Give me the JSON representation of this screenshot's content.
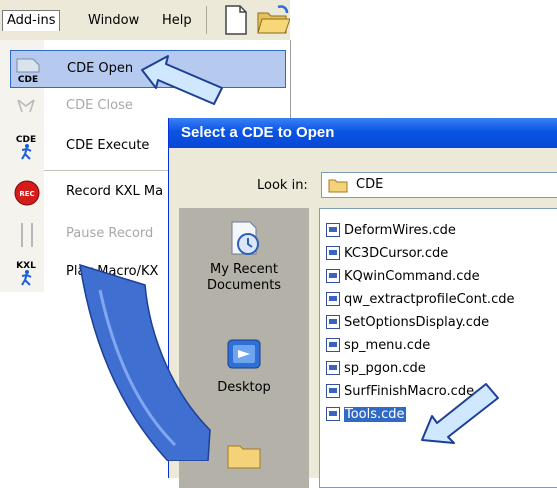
{
  "menubar": {
    "items": [
      {
        "label": "Add-ins",
        "active": true
      },
      {
        "label": "Window"
      },
      {
        "label": "Help"
      }
    ]
  },
  "menu": {
    "items": [
      {
        "label": "CDE Open",
        "icon": "cde-open-icon",
        "selected": true
      },
      {
        "label": "CDE Close",
        "icon": "cde-close-icon",
        "disabled": true
      },
      {
        "label": "CDE Execute",
        "icon": "cde-execute-icon"
      },
      {
        "label": "Record KXL Ma",
        "icon": "record-icon"
      },
      {
        "label": "Pause Record",
        "icon": "pause-icon",
        "disabled": true
      },
      {
        "label": "Play Macro/KX",
        "icon": "kxl-play-icon"
      }
    ],
    "icon_text": {
      "cde": "CDE",
      "rec": "REC",
      "kxl": "KXL"
    }
  },
  "dialog": {
    "title": "Select a CDE to Open",
    "look_in_label": "Look in:",
    "look_in_value": "CDE",
    "places": [
      {
        "label": "My Recent Documents",
        "icon": "recent-documents-icon"
      },
      {
        "label": "Desktop",
        "icon": "desktop-icon"
      }
    ],
    "files": [
      "DeformWires.cde",
      "KC3DCursor.cde",
      "KQwinCommand.cde",
      "qw_extractprofileCont.cde",
      "SetOptionsDisplay.cde",
      "sp_menu.cde",
      "sp_pgon.cde",
      "SurfFinishMacro.cde",
      "Tools.cde"
    ],
    "selected_file": "Tools.cde"
  },
  "colors": {
    "titlebar": "#0a54e3",
    "selection": "#316ac5",
    "menu_highlight": "#b6c9ef",
    "arrow_fill": "#cfe8ff",
    "curve_fill": "#3f6fd1"
  }
}
